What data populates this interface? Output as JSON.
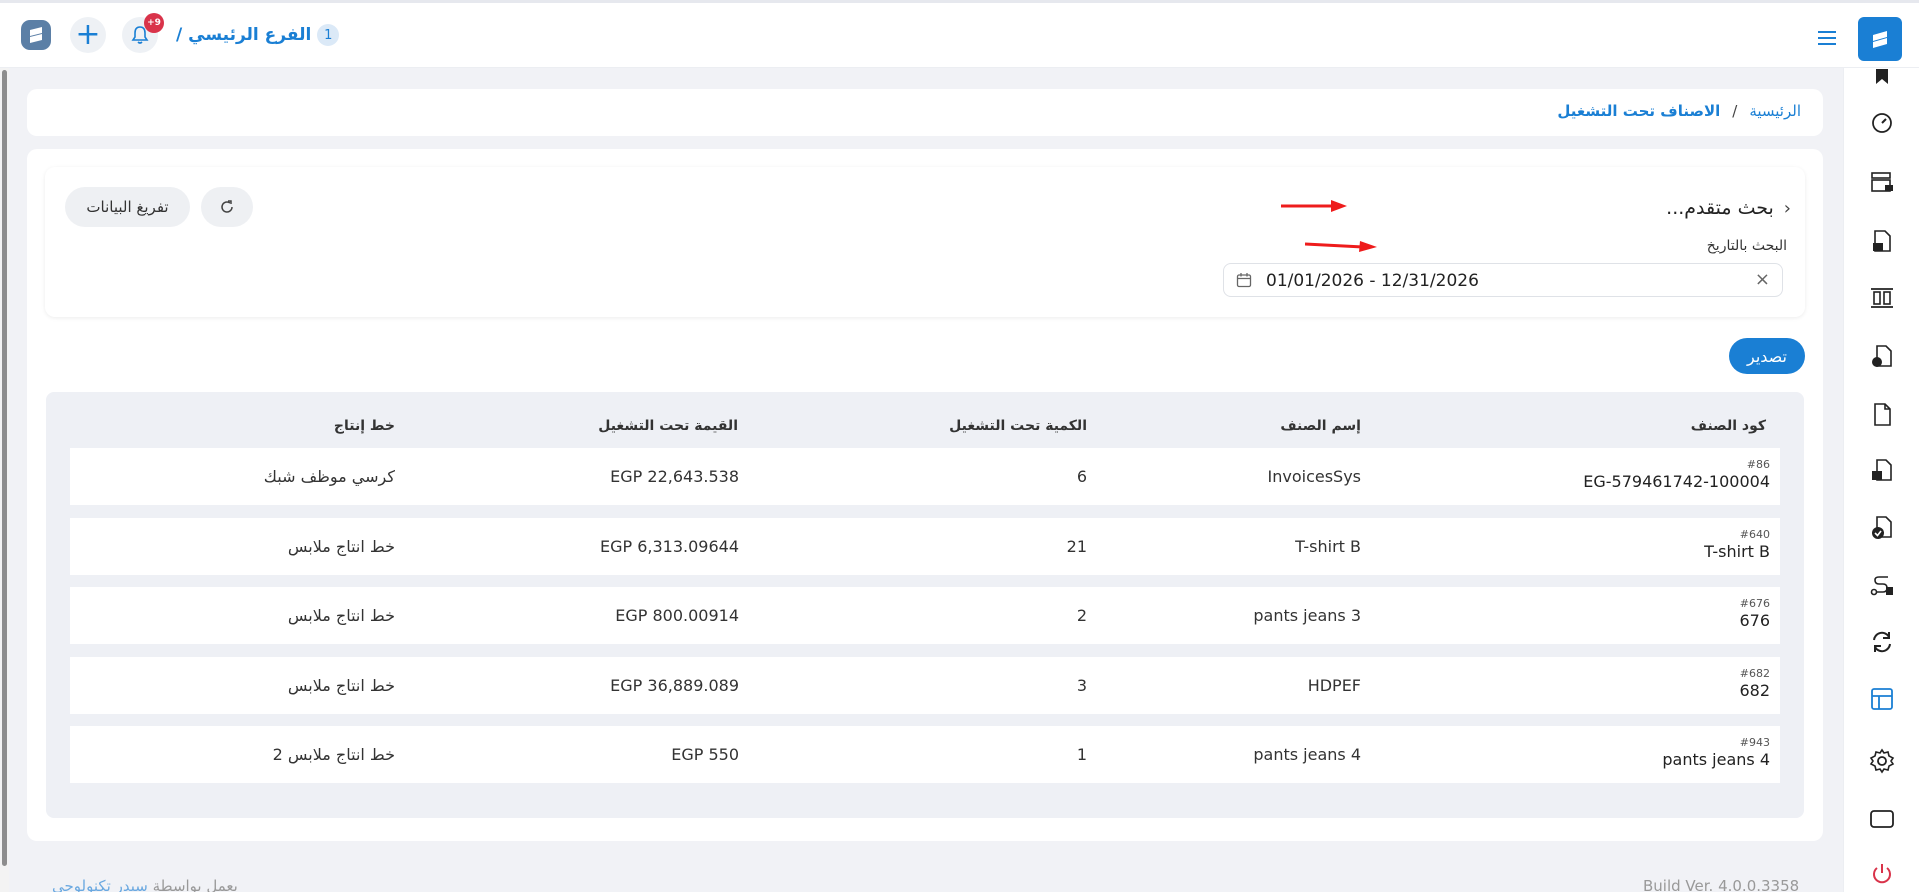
{
  "topbar": {
    "branch_name": "الفرع الرئيسي /",
    "branch_number": "1",
    "notifications_badge": "+9",
    "add_icon": "plus-icon",
    "bell_icon": "bell-icon",
    "menu_icon": "hamburger-menu-icon"
  },
  "breadcrumb": {
    "home": "الرئيسية",
    "separator": "/",
    "current": "الاصناف تحت التشغيل"
  },
  "filter": {
    "advanced_search": "بحث متقدم...",
    "date_label": "البحث بالتاريخ",
    "date_range_value": "01/01/2026 - 12/31/2026",
    "clear_button": "تفريغ البيانات"
  },
  "export_button": "تصدير",
  "table": {
    "headers": [
      "كود الصنف",
      "إسم الصنف",
      "الكمية تحت التشغيل",
      "القيمة تحت التشغيل",
      "خط إنتاج"
    ],
    "rows": [
      {
        "code_num": "#86",
        "code": "EG-579461742-100004",
        "name": "InvoicesSys",
        "qty": "6",
        "value": "EGP 22,643.538",
        "line": "كرسي موظف شبك"
      },
      {
        "code_num": "#640",
        "code": "T-shirt B",
        "name": "T-shirt B",
        "qty": "21",
        "value": "EGP 6,313.09644",
        "line": "خط انتاج ملابس"
      },
      {
        "code_num": "#676",
        "code": "676",
        "name": "pants jeans 3",
        "qty": "2",
        "value": "EGP 800.00914",
        "line": "خط انتاج ملابس"
      },
      {
        "code_num": "#682",
        "code": "682",
        "name": "HDPEF",
        "qty": "3",
        "value": "EGP 36,889.089",
        "line": "خط انتاج ملابس"
      },
      {
        "code_num": "#943",
        "code": "pants jeans 4",
        "name": "pants jeans 4",
        "qty": "1",
        "value": "EGP 550",
        "line": "خط انتاج ملابس 2"
      }
    ]
  },
  "footer": {
    "powered_prefix": "يعمل بواسطة",
    "powered_link": "سيدر تكنولوجي",
    "build": "Build Ver. 4.0.0.3358"
  },
  "sidebar_icons": [
    "bookmark-icon",
    "speedometer-icon",
    "pos-register-icon",
    "document-briefcase-icon",
    "columns-icon",
    "document-money-icon",
    "document-icon",
    "document-box-icon",
    "document-check-icon",
    "route-icon",
    "refresh-cycle-icon",
    "layout-grid-icon",
    "gear-icon",
    "tablet-icon",
    "power-icon"
  ],
  "colors": {
    "accent": "#1a7fd4",
    "red_badge": "#d9334a"
  }
}
